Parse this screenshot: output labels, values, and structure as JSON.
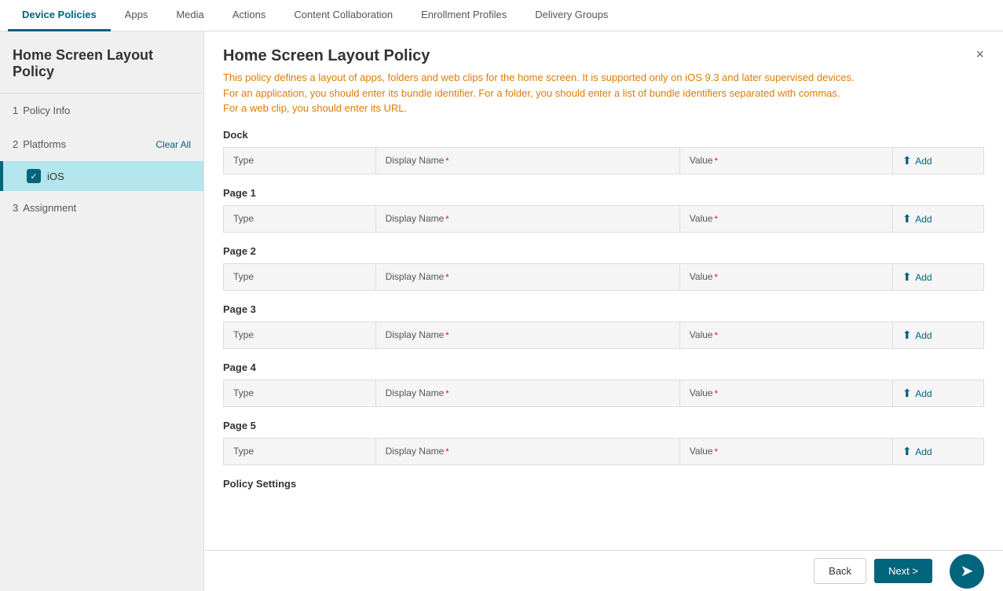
{
  "topnav": {
    "items": [
      {
        "label": "Device Policies",
        "active": true
      },
      {
        "label": "Apps",
        "active": false
      },
      {
        "label": "Media",
        "active": false
      },
      {
        "label": "Actions",
        "active": false
      },
      {
        "label": "Content Collaboration",
        "active": false
      },
      {
        "label": "Enrollment Profiles",
        "active": false
      },
      {
        "label": "Delivery Groups",
        "active": false
      }
    ]
  },
  "sidebar": {
    "title": "Home Screen Layout Policy",
    "steps": [
      {
        "number": "1",
        "label": "Policy Info"
      },
      {
        "number": "2",
        "label": "Platforms",
        "clearAll": "Clear All"
      },
      {
        "number": "3",
        "label": "Assignment"
      }
    ],
    "ios_label": "iOS"
  },
  "content": {
    "title": "Home Screen Layout Policy",
    "description_line1": "This policy defines a layout of apps, folders and web clips for the home screen. It is supported only on iOS 9.3 and later supervised devices.",
    "description_line2": "For an application, you should enter its bundle identifier. For a folder, you should enter a list of bundle identifiers separated with commas.",
    "description_line3": "For a web clip, you should enter its URL.",
    "sections": [
      {
        "label": "Dock"
      },
      {
        "label": "Page 1"
      },
      {
        "label": "Page 2"
      },
      {
        "label": "Page 3"
      },
      {
        "label": "Page 4"
      },
      {
        "label": "Page 5"
      }
    ],
    "table_headers": {
      "type": "Type",
      "display_name": "Display Name",
      "value": "Value",
      "add": "Add"
    },
    "policy_settings_label": "Policy Settings"
  },
  "footer": {
    "back_label": "Back",
    "next_label": "Next >",
    "nav_icon": "➤"
  }
}
